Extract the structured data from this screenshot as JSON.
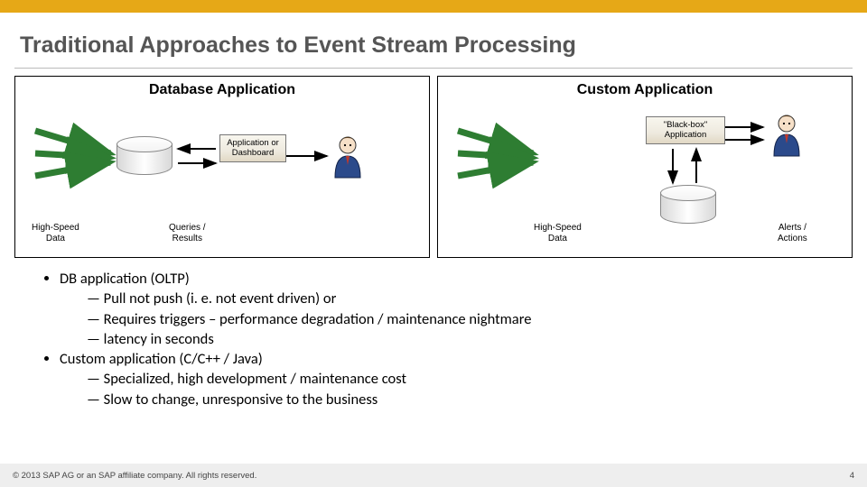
{
  "title": "Traditional Approaches to Event Stream Processing",
  "panels": {
    "db": {
      "title": "Database Application",
      "box": "Application\nor\nDashboard",
      "left_label": "High-Speed\nData",
      "right_label": "Queries /\nResults"
    },
    "custom": {
      "title": "Custom Application",
      "box": "\"Black-box\"\nApplication",
      "left_label": "High-Speed\nData",
      "right_label": "Alerts /\nActions"
    }
  },
  "bullets": {
    "db_title": "DB application (OLTP)",
    "db_items": [
      "Pull not push (i. e. not event driven) or",
      "Requires triggers – performance degradation / maintenance nightmare",
      "latency in seconds"
    ],
    "custom_title": "Custom application (C/C++ / Java)",
    "custom_items": [
      "Specialized, high development / maintenance cost",
      "Slow to change, unresponsive to the business"
    ]
  },
  "footer": {
    "copyright": "©  2013 SAP AG or an SAP affiliate company. All rights reserved.",
    "page": "4"
  }
}
